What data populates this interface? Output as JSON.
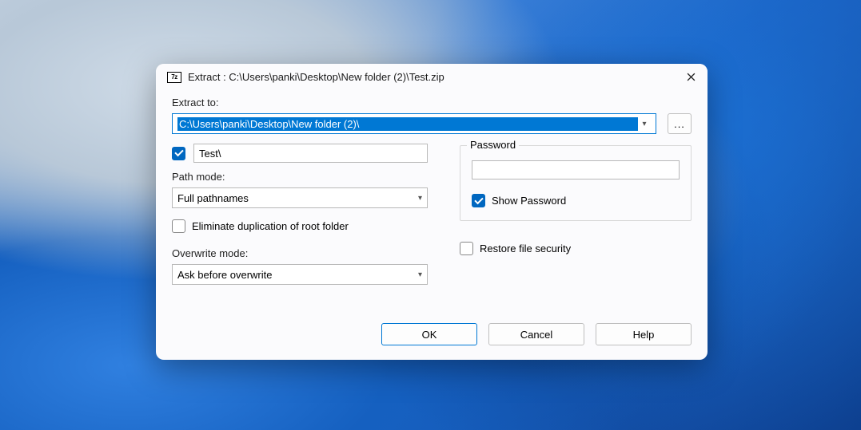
{
  "window": {
    "app_icon_text": "7z",
    "title": "Extract : C:\\Users\\panki\\Desktop\\New folder (2)\\Test.zip"
  },
  "extract_to": {
    "label": "Extract to:",
    "value": "C:\\Users\\panki\\Desktop\\New folder (2)\\",
    "browse_label": "..."
  },
  "subfolder": {
    "checked": true,
    "value": "Test\\"
  },
  "path_mode": {
    "label": "Path mode:",
    "value": "Full pathnames"
  },
  "eliminate_dup": {
    "checked": false,
    "label": "Eliminate duplication of root folder"
  },
  "overwrite_mode": {
    "label": "Overwrite mode:",
    "value": "Ask before overwrite"
  },
  "password": {
    "legend": "Password",
    "value": "",
    "show_checked": true,
    "show_label": "Show Password"
  },
  "restore_security": {
    "checked": false,
    "label": "Restore file security"
  },
  "buttons": {
    "ok": "OK",
    "cancel": "Cancel",
    "help": "Help"
  }
}
